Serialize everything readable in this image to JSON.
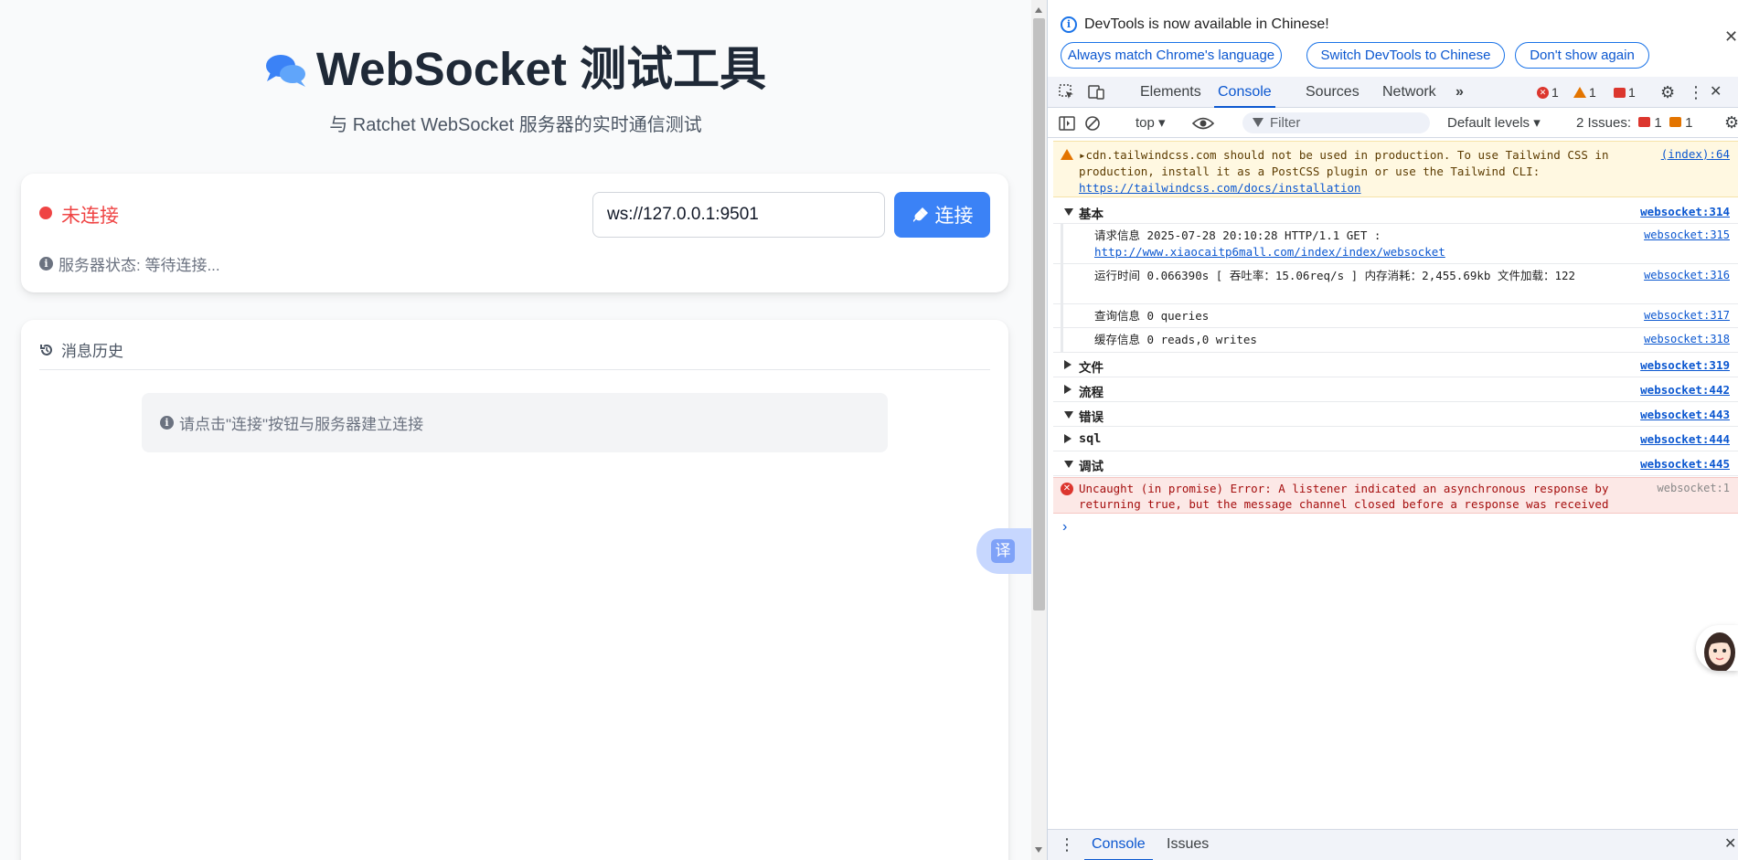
{
  "app": {
    "title": "WebSocket 测试工具",
    "subtitle": "与 Ratchet WebSocket 服务器的实时通信测试",
    "status_label": "未连接",
    "url_value": "ws://127.0.0.1:9501",
    "connect_label": "连接",
    "server_status": "服务器状态: 等待连接...",
    "history_title": "消息历史",
    "empty_message": "请点击\"连接\"按钮与服务器建立连接",
    "translate_label": "译",
    "colors": {
      "accent": "#3b82f6",
      "danger": "#ef4444"
    }
  },
  "devtools": {
    "notice": {
      "text": "DevTools is now available in Chinese!",
      "buttons": [
        "Always match Chrome's language",
        "Switch DevTools to Chinese",
        "Don't show again"
      ]
    },
    "tabs": [
      "Elements",
      "Console",
      "Sources",
      "Network"
    ],
    "active_tab": "Console",
    "counts": {
      "errors": "1",
      "warnings": "1",
      "issues": "1"
    },
    "toolbar": {
      "context": "top",
      "filter_placeholder": "Filter",
      "levels": "Default levels",
      "issues_label": "2 Issues:",
      "issue_error_count": "1",
      "issue_warning_count": "1"
    },
    "console": {
      "warning": {
        "text_1": "cdn.tailwindcss.com should not be used in production. To use Tailwind CSS in production, install it as a PostCSS plugin or use the Tailwind CLI: ",
        "link": "https://tailwindcss.com/docs/installation",
        "source": "(index):64"
      },
      "group_basic": {
        "label": "基本",
        "source": "websocket:314"
      },
      "children": [
        {
          "text": "请求信息 2025-07-28 20:10:28 HTTP/1.1 GET : ",
          "link": "http://www.xiaocaitp6mall.com/index/index/websocket",
          "source": "websocket:315"
        },
        {
          "text": "运行时间 0.066390s [ 吞吐率：15.06req/s ] 内存消耗：2,455.69kb 文件加载：122",
          "link": "",
          "source": "websocket:316"
        },
        {
          "text": "查询信息 0 queries",
          "link": "",
          "source": "websocket:317"
        },
        {
          "text": "缓存信息 0 reads,0 writes",
          "link": "",
          "source": "websocket:318"
        }
      ],
      "groups": [
        {
          "label": "文件",
          "source": "websocket:319",
          "expanded": false
        },
        {
          "label": "流程",
          "source": "websocket:442",
          "expanded": false
        },
        {
          "label": "错误",
          "source": "websocket:443",
          "expanded": true
        },
        {
          "label": "sql",
          "source": "websocket:444",
          "expanded": false
        },
        {
          "label": "调试",
          "source": "websocket:445",
          "expanded": true
        }
      ],
      "error": {
        "text": "Uncaught (in promise) Error: A listener indicated an asynchronous response by returning true, but the message channel closed before a response was received",
        "source": "websocket:1"
      }
    },
    "drawer_tabs": [
      "Console",
      "Issues"
    ]
  }
}
